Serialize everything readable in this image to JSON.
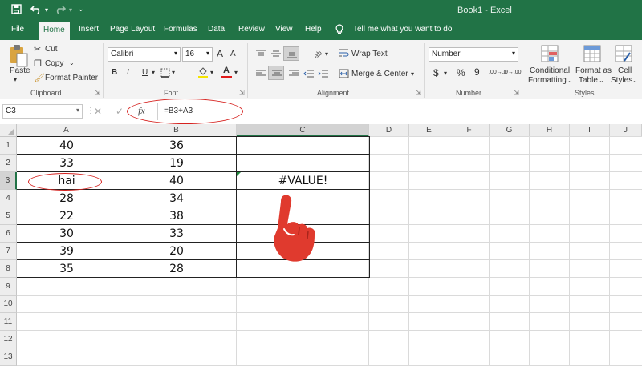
{
  "window": {
    "title": "Book1  -  Excel"
  },
  "quick_access": {
    "save_icon": "save-icon",
    "undo_icon": "undo-icon",
    "redo_icon": "redo-icon"
  },
  "tabs": [
    {
      "label": "File"
    },
    {
      "label": "Home"
    },
    {
      "label": "Insert"
    },
    {
      "label": "Page Layout"
    },
    {
      "label": "Formulas"
    },
    {
      "label": "Data"
    },
    {
      "label": "Review"
    },
    {
      "label": "View"
    },
    {
      "label": "Help"
    }
  ],
  "tell_me": "Tell me what you want to do",
  "ribbon": {
    "clipboard": {
      "paste": "Paste",
      "cut": "Cut",
      "copy": "Copy",
      "format_painter": "Format Painter",
      "label": "Clipboard"
    },
    "font": {
      "name": "Calibri",
      "size": "16",
      "bold": "B",
      "italic": "I",
      "underline": "U",
      "label": "Font",
      "grow": "A",
      "shrink": "A",
      "font_color_glyph": "A"
    },
    "alignment": {
      "wrap_text": "Wrap Text",
      "merge_center": "Merge & Center",
      "label": "Alignment"
    },
    "number": {
      "format": "Number",
      "currency": "$",
      "percent": "%",
      "comma": "9",
      "inc_decimal": ".00→.0",
      "dec_decimal": ".0→.00",
      "label": "Number"
    },
    "styles": {
      "conditional_1": "Conditional",
      "conditional_2": "Formatting",
      "format_table_1": "Format as",
      "format_table_2": "Table",
      "cell_styles_1": "Cell",
      "cell_styles_2": "Styles",
      "label": "Styles"
    }
  },
  "formula_bar": {
    "name_box": "C3",
    "fx": "fx",
    "formula": "=B3+A3"
  },
  "columns": [
    "A",
    "B",
    "C",
    "D",
    "E",
    "F",
    "G",
    "H",
    "I",
    "J"
  ],
  "rows": [
    "1",
    "2",
    "3",
    "4",
    "5",
    "6",
    "7",
    "8",
    "9",
    "10",
    "11",
    "12",
    "13"
  ],
  "cells": {
    "A": [
      "40",
      "33",
      "hai",
      "28",
      "22",
      "30",
      "39",
      "35"
    ],
    "B": [
      "36",
      "19",
      "40",
      "34",
      "38",
      "33",
      "20",
      "28"
    ],
    "C3": "#VALUE!"
  },
  "annotation": {
    "color": "#d6221f",
    "hand_icon": "pointing-hand-icon"
  },
  "colors": {
    "brand": "#217346",
    "ribbon_bg": "#f3f3f3",
    "header_bg": "#ededed",
    "grid": "#dadada"
  }
}
